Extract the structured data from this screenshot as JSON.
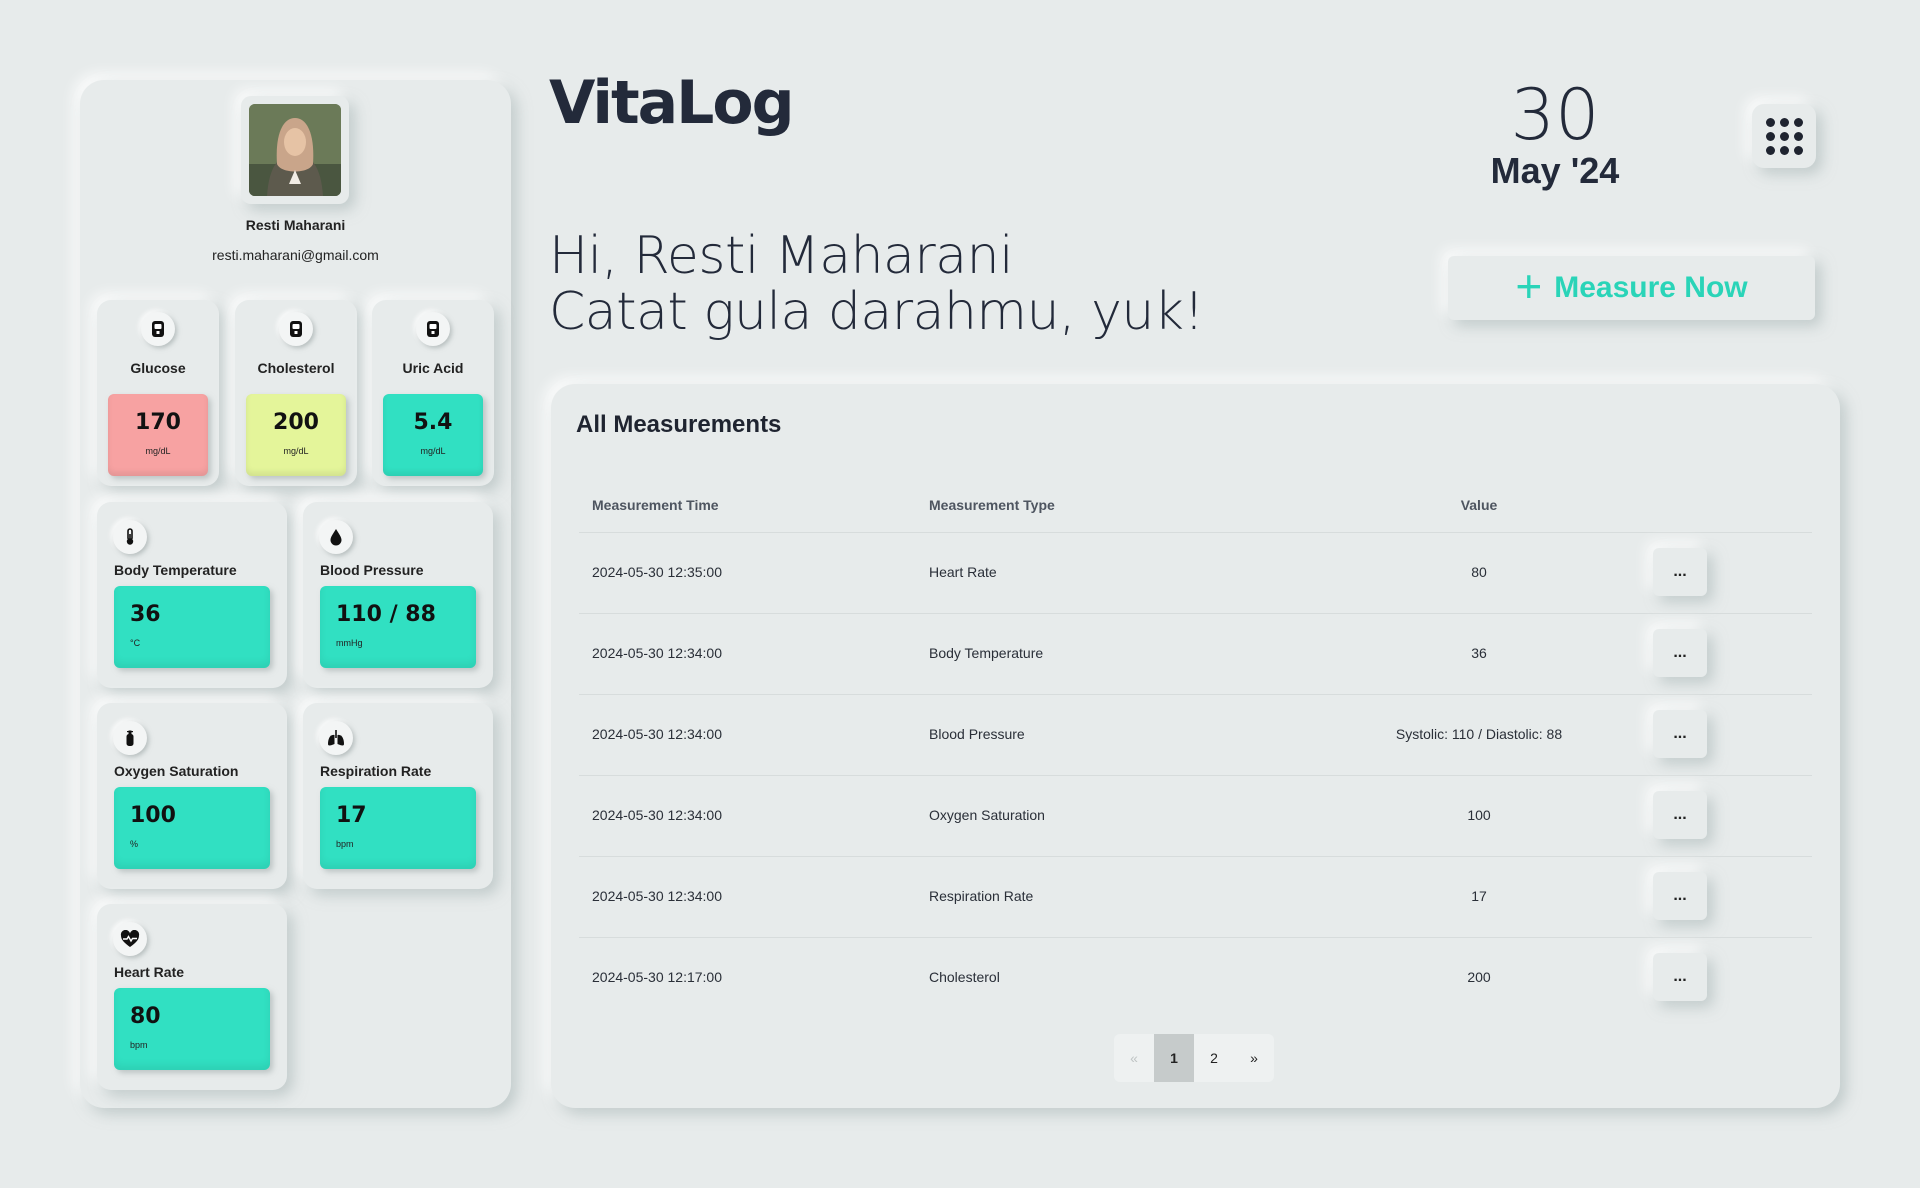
{
  "app": {
    "logo": "VitaLog"
  },
  "date": {
    "day": "30",
    "month_year": "May '24"
  },
  "user": {
    "name": "Resti Maharani",
    "email": "resti.maharani@gmail.com"
  },
  "greeting": {
    "line1": "Hi, Resti Maharani",
    "line2": "Catat gula darahmu, yuk!"
  },
  "measure_button": {
    "label": "Measure Now"
  },
  "colors": {
    "accent": "#2ad4b8",
    "teal_box": "#31e0c2",
    "glucose_box": "#f7a2a2",
    "cholesterol_box": "#e4f59a",
    "uric_box": "#31e0c2",
    "background": "#e7ebeb"
  },
  "metrics": {
    "glucose": {
      "label": "Glucose",
      "value": "170",
      "unit": "mg/dL",
      "icon": "glucometer-icon"
    },
    "cholesterol": {
      "label": "Cholesterol",
      "value": "200",
      "unit": "mg/dL",
      "icon": "glucometer-icon"
    },
    "uric_acid": {
      "label": "Uric Acid",
      "value": "5.4",
      "unit": "mg/dL",
      "icon": "glucometer-icon"
    },
    "body_temperature": {
      "label": "Body Temperature",
      "value": "36",
      "unit": "°C",
      "icon": "thermometer-icon"
    },
    "blood_pressure": {
      "label": "Blood Pressure",
      "value": "110 / 88",
      "unit": "mmHg",
      "icon": "blood-drop-icon"
    },
    "oxygen_saturation": {
      "label": "Oxygen Saturation",
      "value": "100",
      "unit": "%",
      "icon": "oxygen-tank-icon"
    },
    "respiration_rate": {
      "label": "Respiration Rate",
      "value": "17",
      "unit": "bpm",
      "icon": "lungs-icon"
    },
    "heart_rate": {
      "label": "Heart Rate",
      "value": "80",
      "unit": "bpm",
      "icon": "heart-pulse-icon"
    }
  },
  "table": {
    "title": "All Measurements",
    "columns": [
      "Measurement Time",
      "Measurement Type",
      "Value"
    ],
    "rows": [
      {
        "time": "2024-05-30 12:35:00",
        "type": "Heart Rate",
        "value": "80",
        "action": "..."
      },
      {
        "time": "2024-05-30 12:34:00",
        "type": "Body Temperature",
        "value": "36",
        "action": "..."
      },
      {
        "time": "2024-05-30 12:34:00",
        "type": "Blood Pressure",
        "value": "Systolic: 110 / Diastolic: 88",
        "action": "..."
      },
      {
        "time": "2024-05-30 12:34:00",
        "type": "Oxygen Saturation",
        "value": "100",
        "action": "..."
      },
      {
        "time": "2024-05-30 12:34:00",
        "type": "Respiration Rate",
        "value": "17",
        "action": "..."
      },
      {
        "time": "2024-05-30 12:17:00",
        "type": "Cholesterol",
        "value": "200",
        "action": "..."
      }
    ]
  },
  "pagination": {
    "prev": "«",
    "pages": [
      "1",
      "2"
    ],
    "next": "»",
    "current": "1"
  }
}
